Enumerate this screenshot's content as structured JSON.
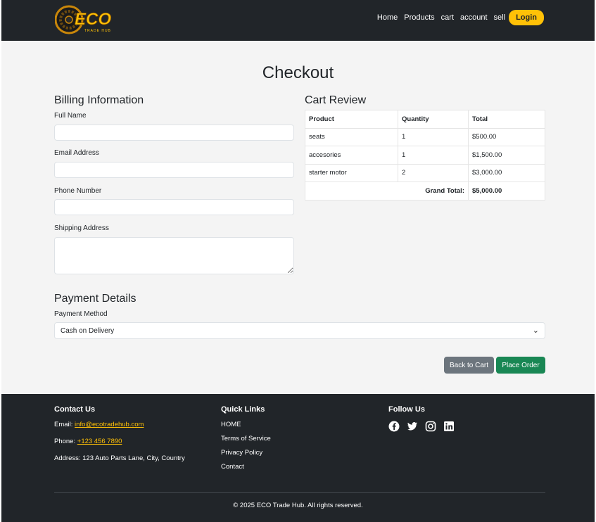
{
  "brand": {
    "logo_text": "ECO",
    "logo_subtext": "TRADE HUB"
  },
  "nav": {
    "links": [
      "Home",
      "Products",
      "cart",
      "account",
      "sell"
    ],
    "login_label": "Login"
  },
  "checkout": {
    "title": "Checkout",
    "billing": {
      "heading": "Billing Information",
      "full_name_label": "Full Name",
      "full_name_value": "",
      "email_label": "Email Address",
      "email_value": "",
      "phone_label": "Phone Number",
      "phone_value": "",
      "address_label": "Shipping Address",
      "address_value": ""
    },
    "cart_review": {
      "heading": "Cart Review",
      "columns": [
        "Product",
        "Quantity",
        "Total"
      ],
      "rows": [
        {
          "product": "seats",
          "quantity": "1",
          "total": "$500.00"
        },
        {
          "product": "accesories",
          "quantity": "1",
          "total": "$1,500.00"
        },
        {
          "product": "starter motor",
          "quantity": "2",
          "total": "$3,000.00"
        }
      ],
      "grand_total_label": "Grand Total:",
      "grand_total_value": "$5,000.00"
    },
    "payment": {
      "heading": "Payment Details",
      "method_label": "Payment Method",
      "method_value": "Cash on Delivery"
    },
    "back_label": "Back to Cart",
    "place_label": "Place Order"
  },
  "footer": {
    "contact": {
      "heading": "Contact Us",
      "email_label": "Email:",
      "email_value": "info@ecotradehub.com",
      "phone_label": "Phone:",
      "phone_value": "+123 456 7890",
      "address": "Address: 123 Auto Parts Lane, City, Country"
    },
    "quick_links": {
      "heading": "Quick Links",
      "links": [
        "HOME",
        "Terms of Service",
        "Privacy Policy",
        "Contact"
      ]
    },
    "follow": {
      "heading": "Follow Us",
      "icons": [
        "facebook-icon",
        "twitter-icon",
        "instagram-icon",
        "linkedin-icon"
      ]
    },
    "copyright": "© 2025 ECO Trade Hub. All rights reserved."
  },
  "colors": {
    "nav_bg": "#212529",
    "accent": "#ffc107",
    "page_bg": "#f4f4f4",
    "back_btn": "#6c757d",
    "place_btn": "#198754"
  }
}
